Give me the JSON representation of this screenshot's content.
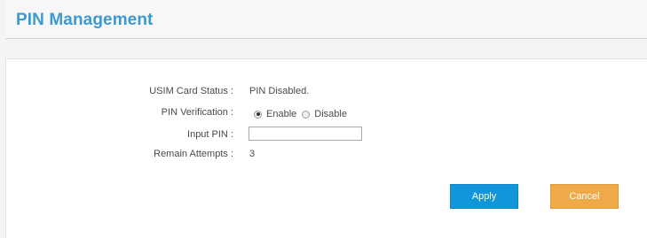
{
  "header": {
    "title": "PIN Management"
  },
  "form": {
    "usim_status": {
      "label": "USIM Card Status :",
      "value": "PIN Disabled."
    },
    "pin_verification": {
      "label": "PIN Verification :",
      "options": [
        {
          "label": "Enable",
          "selected": true
        },
        {
          "label": "Disable",
          "selected": false
        }
      ]
    },
    "input_pin": {
      "label": "Input PIN :",
      "value": ""
    },
    "remain_attempts": {
      "label": "Remain Attempts :",
      "value": "3"
    }
  },
  "buttons": {
    "apply_label": "Apply",
    "cancel_label": "Cancel"
  },
  "colors": {
    "title": "#3c9ad3",
    "apply": "#1296db",
    "cancel": "#f0a948"
  }
}
